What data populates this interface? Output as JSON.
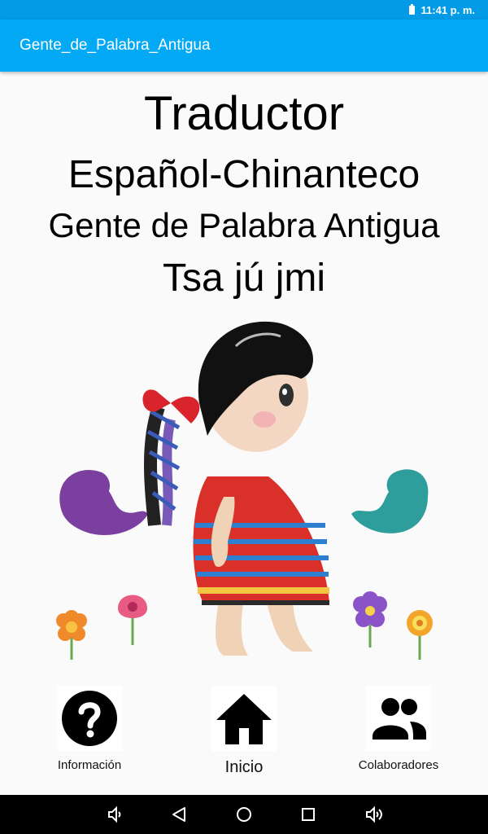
{
  "status_bar": {
    "time": "11:41 p. m.",
    "battery_icon": "battery-icon"
  },
  "app_bar": {
    "title": "Gente_de_Palabra_Antigua"
  },
  "header": {
    "line1": "Traductor",
    "line2": "Español-Chinanteco",
    "line3": "Gente de Palabra Antigua",
    "line4": "Tsa jú jmi"
  },
  "bottom_nav": {
    "info": {
      "label": "Información",
      "icon": "question-circle-icon"
    },
    "home": {
      "label": "Inicio",
      "icon": "home-icon"
    },
    "collaborators": {
      "label": "Colaboradores",
      "icon": "people-icon"
    }
  },
  "system_nav": [
    "volume-down-icon",
    "back-icon",
    "home-circle-icon",
    "recents-icon",
    "volume-up-icon"
  ],
  "colors": {
    "status_bar": "#039be5",
    "app_bar": "#03a9f4",
    "background": "#fafafa"
  }
}
